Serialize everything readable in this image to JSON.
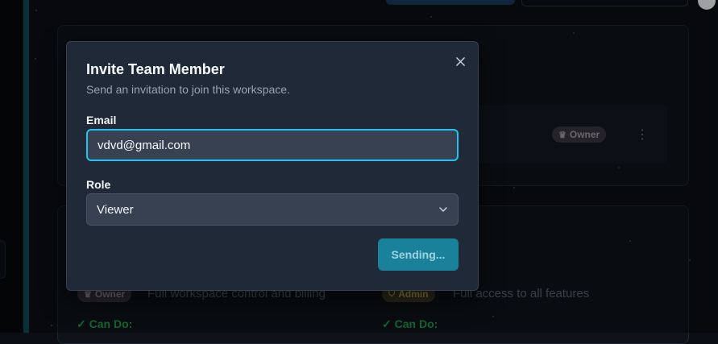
{
  "background": {
    "badges": {
      "owner_label": "Owner",
      "admin_label": "Admin"
    },
    "roles": {
      "owner_description": "Full workspace control and billing",
      "admin_description": "Full access to all features",
      "can_do_label": "✓ Can Do:"
    }
  },
  "modal": {
    "title": "Invite Team Member",
    "subtitle": "Send an invitation to join this workspace.",
    "close_icon": "close-icon",
    "email": {
      "label": "Email",
      "value": "vdvd@gmail.com"
    },
    "role": {
      "label": "Role",
      "selected": "Viewer"
    },
    "submit_label": "Sending..."
  },
  "colors": {
    "accent": "#22c3ee",
    "submit_button": "#19829a",
    "modal_background": "#1f2937",
    "can_do_green": "#1f9a4d"
  }
}
